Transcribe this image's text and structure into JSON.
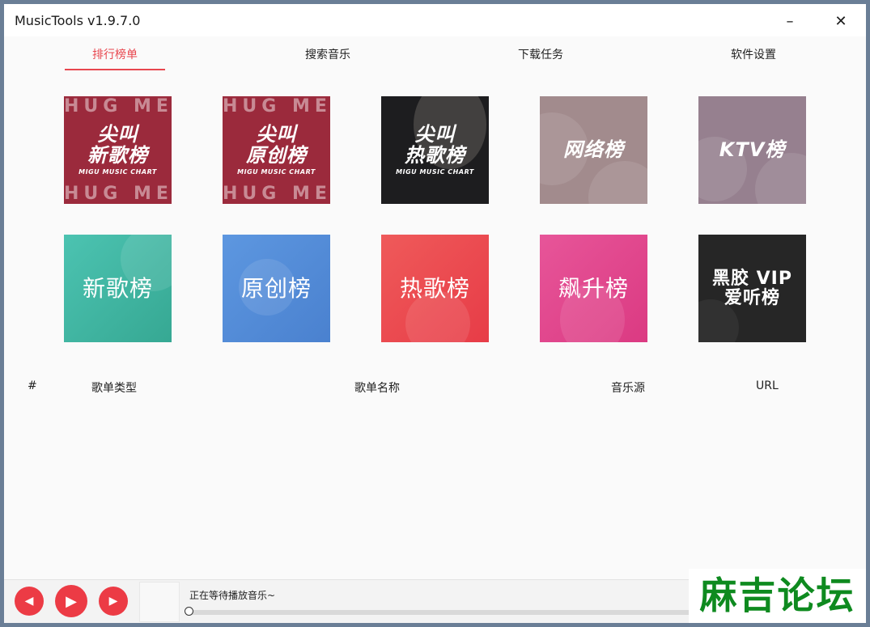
{
  "window": {
    "title": "MusicTools v1.9.7.0",
    "minimize_label": "–",
    "close_label": "✕"
  },
  "tabs": [
    {
      "label": "排行榜单",
      "active": true
    },
    {
      "label": "搜索音乐",
      "active": false
    },
    {
      "label": "下载任务",
      "active": false
    },
    {
      "label": "软件设置",
      "active": false
    }
  ],
  "charts_row1": [
    {
      "deco": "HUG ME",
      "title_line1": "尖叫",
      "title_line2": "新歌榜",
      "subtitle": "MIGU MUSIC CHART"
    },
    {
      "deco": "HUG ME",
      "title_line1": "尖叫",
      "title_line2": "原创榜",
      "subtitle": "MIGU MUSIC CHART"
    },
    {
      "title_line1": "尖叫",
      "title_line2": "热歌榜",
      "subtitle": "MIGU MUSIC CHART"
    },
    {
      "title_line1": "网络榜"
    },
    {
      "title_line1": "KTV榜"
    }
  ],
  "charts_row2": [
    {
      "title_line1": "新歌榜"
    },
    {
      "title_line1": "原创榜"
    },
    {
      "title_line1": "热歌榜"
    },
    {
      "title_line1": "飙升榜"
    },
    {
      "title_line1": "黑胶 VIP",
      "title_line2": "爱听榜"
    }
  ],
  "table": {
    "columns": [
      "#",
      "歌单类型",
      "歌单名称",
      "音乐源",
      "URL"
    ],
    "rows": []
  },
  "player": {
    "status_text": "正在等待播放音乐~",
    "progress": 0,
    "prev_icon": "◀",
    "play_icon": "▶",
    "next_icon": "▶"
  },
  "watermark": "麻吉论坛",
  "colors": {
    "accent": "#e8474f",
    "player_button": "#ec3b45",
    "watermark": "#0e8a1f"
  }
}
